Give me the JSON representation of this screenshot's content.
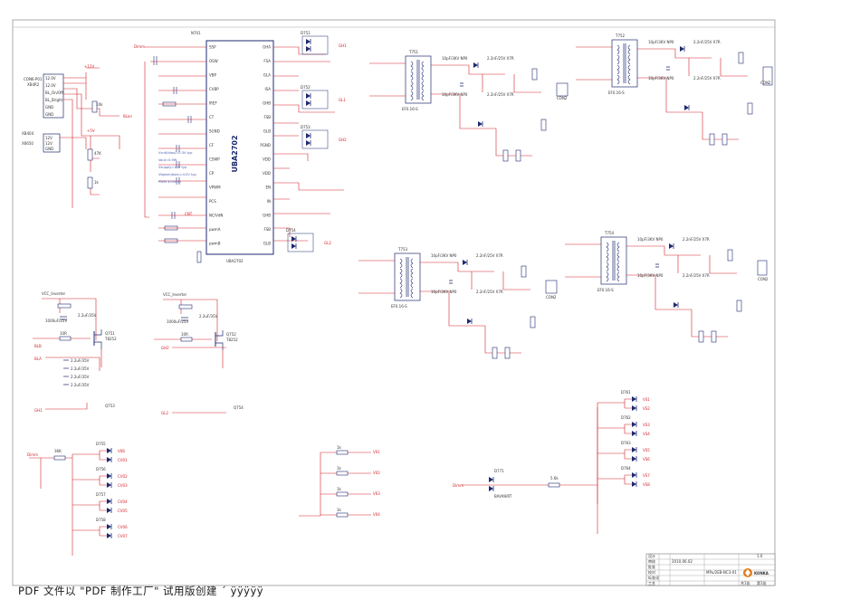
{
  "schematic": {
    "ic_main": {
      "ref": "N701",
      "part": "UBA2702",
      "part_small": "UBA2702",
      "pins_left": [
        "SSP",
        "OSW",
        "VBP",
        "CVBP",
        "IREF",
        "CT",
        "SGND",
        "CF",
        "CSWP",
        "CP",
        "VPWM",
        "PCS",
        "NC/VdN",
        "pwmA",
        "pwmB"
      ],
      "pins_right": [
        "GHA",
        "FSA",
        "GLA",
        "ISA",
        "GHB",
        "FSB",
        "GLB",
        "PGND",
        "VDD",
        "VDD",
        "EN",
        "IN",
        "GHB",
        "FSB",
        "GLB"
      ]
    },
    "connectors": {
      "con1": {
        "ref": "CON6-P01",
        "sub": "XB4R2",
        "pins": [
          "12.0V",
          "12.0V",
          "BL_On/Off",
          "BL_Bright",
          "GND",
          "GND"
        ]
      },
      "con2": {
        "ref": "XB404",
        "sub": "X6650",
        "pins": [
          "12V",
          "12V",
          "GND"
        ]
      },
      "con3": "CON2",
      "con4": "CON2",
      "con5": "CON2",
      "con6": "CON2"
    },
    "rails": [
      "+12V",
      "+5V",
      "VCC_Inverter",
      "+12V_inv",
      "GND"
    ],
    "net_labels": [
      "BLon",
      "GH1",
      "GL1",
      "GH2",
      "GL2",
      "BLB",
      "BLA",
      "Dimm",
      "CNT",
      "ISN",
      "VDO",
      "V01",
      "V02",
      "V03",
      "V04",
      "V05",
      "V06",
      "V07",
      "V08",
      "CV01",
      "CV02",
      "CV03",
      "CV04",
      "CV05",
      "CV06",
      "CV07",
      "CV08",
      "CV09",
      "CV10",
      "VS1",
      "VS2",
      "VS3",
      "VS4",
      "VS5",
      "VS6",
      "VS7",
      "VS8"
    ],
    "transformers": [
      "T751",
      "T752",
      "T753",
      "T754"
    ],
    "transformer_parts": [
      "EF0.16-S",
      "EF0.16-S",
      "EF0.16-S",
      "EF0.16-S"
    ],
    "mosfets": [
      "Q751",
      "Q752",
      "Q753",
      "Q754"
    ],
    "mosfet_parts": [
      "T8252",
      "T8252",
      "T8252",
      "T8252"
    ],
    "diodes": [
      "D751",
      "D752",
      "D753",
      "D754",
      "D755",
      "D756",
      "D757",
      "D758",
      "D759",
      "D760",
      "D761",
      "D762",
      "D763",
      "D764",
      "D765",
      "D766",
      "D767",
      "D768",
      "D769",
      "D770",
      "D771"
    ],
    "diode_part": "BAV99/RT",
    "diode_part2": "BAT54A",
    "cap_values": [
      "100nF/16V",
      "10pF/3KV NP0",
      "2.2nF/25V X7R",
      "1000uF/25V",
      "2.2uF/35V",
      "0.1uF/50V",
      "330pF",
      "10nF",
      "4.7nF"
    ],
    "res_values": [
      "10k",
      "47K",
      "100R",
      "150R 1%",
      "10R",
      "5.6k",
      "22K",
      "1k",
      "36K"
    ],
    "notes": [
      "Vcntl(bias)=0.3V typ",
      "Vout=0.9W",
      "Vsupply=10V typ",
      "Vbpwm(bias)=4.0V typ",
      "PWM 3.0Vmin"
    ]
  },
  "title_block": {
    "company": "KONKA",
    "drawing_no": "MPu/2EB-NC3-01",
    "date": "2010.06.02",
    "rows": [
      "设计",
      "审核",
      "批准",
      "校对",
      "标准化",
      "工艺"
    ],
    "page": "共1张",
    "sheet": "第1张",
    "version": "1.0"
  },
  "footer_text": "PDF 文件以 \"PDF 制作工厂\" 试用版创建 ´ ÿÿÿÿÿ",
  "colors": {
    "wire": "#d2232a",
    "component": "#1f2a70",
    "text_note": "#4a5fb0",
    "border": "#888888",
    "title_accent": "#e07b1a"
  }
}
